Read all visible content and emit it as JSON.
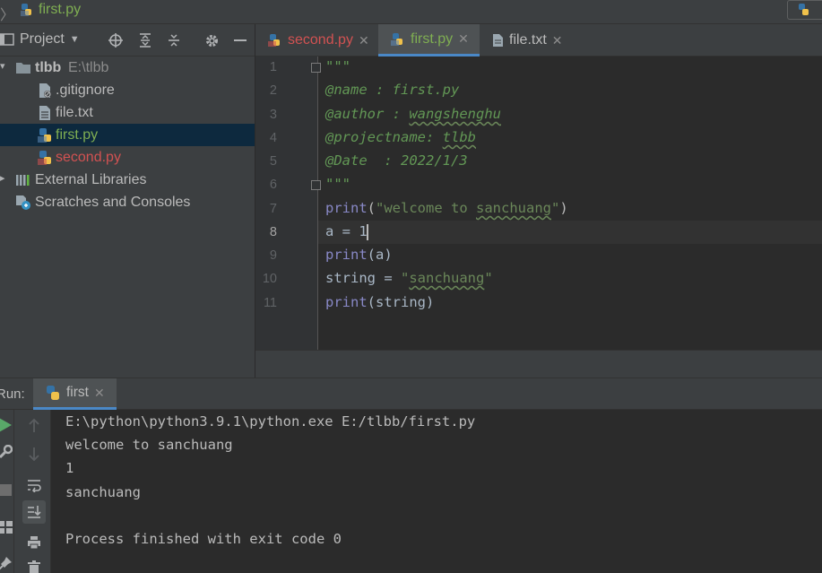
{
  "breadcrumb": {
    "separator": "〉",
    "file": "first.py"
  },
  "project_panel": {
    "title": "Project",
    "items": [
      {
        "label": "tlbb",
        "path": "E:\\tlbb",
        "icon": "folder-icon"
      },
      {
        "label": ".gitignore",
        "icon": "gitignore-file-icon"
      },
      {
        "label": "file.txt",
        "icon": "text-file-icon"
      },
      {
        "label": "first.py",
        "icon": "python-file-icon"
      },
      {
        "label": "second.py",
        "icon": "python-file-icon"
      },
      {
        "label": "External Libraries",
        "icon": "library-icon"
      },
      {
        "label": "Scratches and Consoles",
        "icon": "scratches-icon"
      }
    ]
  },
  "editor": {
    "tabs": [
      {
        "label": "second.py",
        "color": "#d25252"
      },
      {
        "label": "first.py",
        "color": "#7fae52"
      },
      {
        "label": "file.txt",
        "color": "#bbbbbb"
      }
    ],
    "line_numbers": [
      "1",
      "2",
      "3",
      "4",
      "5",
      "6",
      "7",
      "8",
      "9",
      "10",
      "11"
    ],
    "lines": {
      "l1": "\"\"\"",
      "l2": "@name : first.py",
      "l3a": "@author : ",
      "l3b": "wangshenghu",
      "l4a": "@projectname: ",
      "l4b": "tlbb",
      "l5": "@Date  : 2022/1/3",
      "l6": "\"\"\"",
      "l7a": "print",
      "l7b": "(",
      "l7c": "\"welcome to ",
      "l7d": "sanchuang",
      "l7e": "\"",
      "l7f": ")",
      "l8": "a = 1",
      "l9a": "print",
      "l9b": "(a)",
      "l10a": "string = ",
      "l10b": "\"",
      "l10c": "sanchuang",
      "l10d": "\"",
      "l11a": "print",
      "l11b": "(string)"
    }
  },
  "run_panel": {
    "label": "Run:",
    "tab": "first",
    "console": [
      "E:\\python\\python3.9.1\\python.exe E:/tlbb/first.py",
      "welcome to sanchuang",
      "1",
      "sanchuang",
      "",
      "Process finished with exit code 0"
    ]
  },
  "colors": {
    "accent": "#4a88c7",
    "docstring": "#629755",
    "string": "#6a8759",
    "builtin": "#8888c6"
  }
}
